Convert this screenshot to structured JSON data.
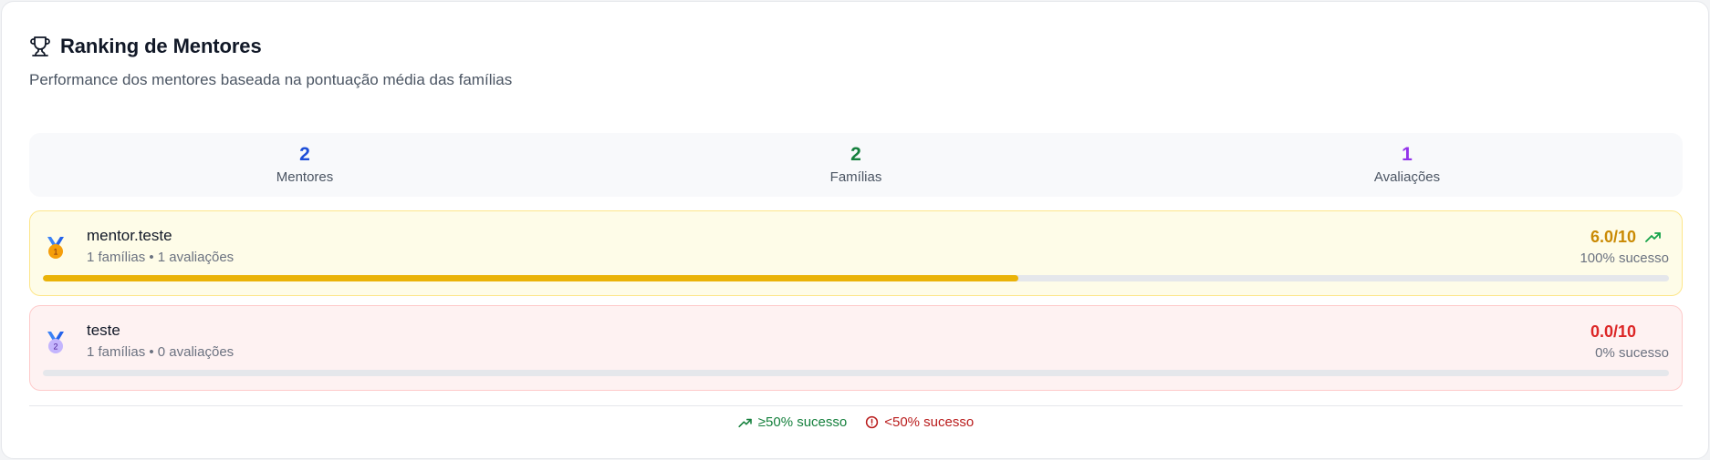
{
  "header": {
    "title": "Ranking de Mentores",
    "subtitle": "Performance dos mentores baseada na pontuação média das famílias"
  },
  "stats": [
    {
      "value": "2",
      "label": "Mentores",
      "color": "#1d4ed8"
    },
    {
      "value": "2",
      "label": "Famílias",
      "color": "#15803d"
    },
    {
      "value": "1",
      "label": "Avaliações",
      "color": "#9333ea"
    }
  ],
  "mentors": [
    {
      "rank": "1",
      "name": "mentor.teste",
      "meta": "1 famílias • 1 avaliações",
      "score": "6.0/10",
      "rate": "100% sucesso",
      "progress": 0.6,
      "trend_icon": "trending-up-icon",
      "colors": {
        "bg": "#fefce8",
        "border": "#fde68a",
        "score": "#ca8a04",
        "bar": "#eab308",
        "medal": "#f59e0b"
      }
    },
    {
      "rank": "2",
      "name": "teste",
      "meta": "1 famílias • 0 avaliações",
      "score": "0.0/10",
      "rate": "0% sucesso",
      "progress": 0.0,
      "colors": {
        "bg": "#fef2f2",
        "border": "#fecaca",
        "score": "#dc2626",
        "bar": "#ef4444",
        "medal": "#c4b5fd"
      }
    }
  ],
  "legend": {
    "success": {
      "label": "≥50% sucesso",
      "icon": "trending-up-icon",
      "color": "#15803d"
    },
    "fail": {
      "label": "<50% sucesso",
      "icon": "alert-circle-icon",
      "color": "#b91c1c"
    }
  }
}
